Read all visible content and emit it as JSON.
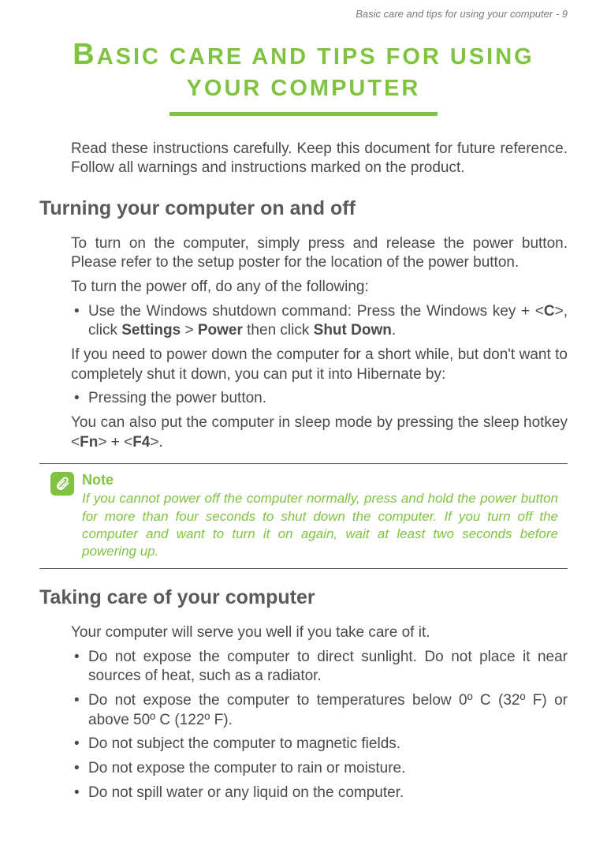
{
  "header": "Basic care and tips for using your computer - 9",
  "title_line1_first": "B",
  "title_line1_rest": "ASIC CARE AND TIPS FOR USING",
  "title_line2": "YOUR COMPUTER",
  "intro": "Read these instructions carefully. Keep this document for future reference. Follow all warnings and instructions marked on the product.",
  "section1": {
    "heading": "Turning your computer on and off",
    "p1": "To turn on the computer, simply press and release the power button. Please refer to the setup poster for the location of the power button.",
    "p2": "To turn the power off, do any of the following:",
    "bullet1_pre": "Use the Windows shutdown command: Press the Windows key + <",
    "bullet1_b1": "C",
    "bullet1_mid1": ">, click ",
    "bullet1_b2": "Settings",
    "bullet1_mid2": " > ",
    "bullet1_b3": "Power",
    "bullet1_mid3": " then click ",
    "bullet1_b4": "Shut Down",
    "bullet1_post": ".",
    "p3": "If you need to power down the computer for a short while, but don't want to completely shut it down, you can put it into Hibernate by:",
    "bullet2": "Pressing the power button.",
    "p4_pre": "You can also put the computer in sleep mode by pressing the sleep hotkey <",
    "p4_b1": "Fn",
    "p4_mid": "> + <",
    "p4_b2": "F4",
    "p4_post": ">."
  },
  "note": {
    "title": "Note",
    "body": "If you cannot power off the computer normally, press and hold the power button for more than four seconds to shut down the computer. If you turn off the computer and want to turn it on again, wait at least two seconds before powering up."
  },
  "section2": {
    "heading": "Taking care of your computer",
    "p1": "Your computer will serve you well if you take care of it.",
    "bullets": [
      "Do not expose the computer to direct sunlight. Do not place it near sources of heat, such as a radiator.",
      "Do not expose the computer to temperatures below 0º C (32º F) or above 50º C (122º F).",
      "Do not subject the computer to magnetic fields.",
      "Do not expose the computer to rain or moisture.",
      "Do not spill water or any liquid on the computer."
    ]
  }
}
